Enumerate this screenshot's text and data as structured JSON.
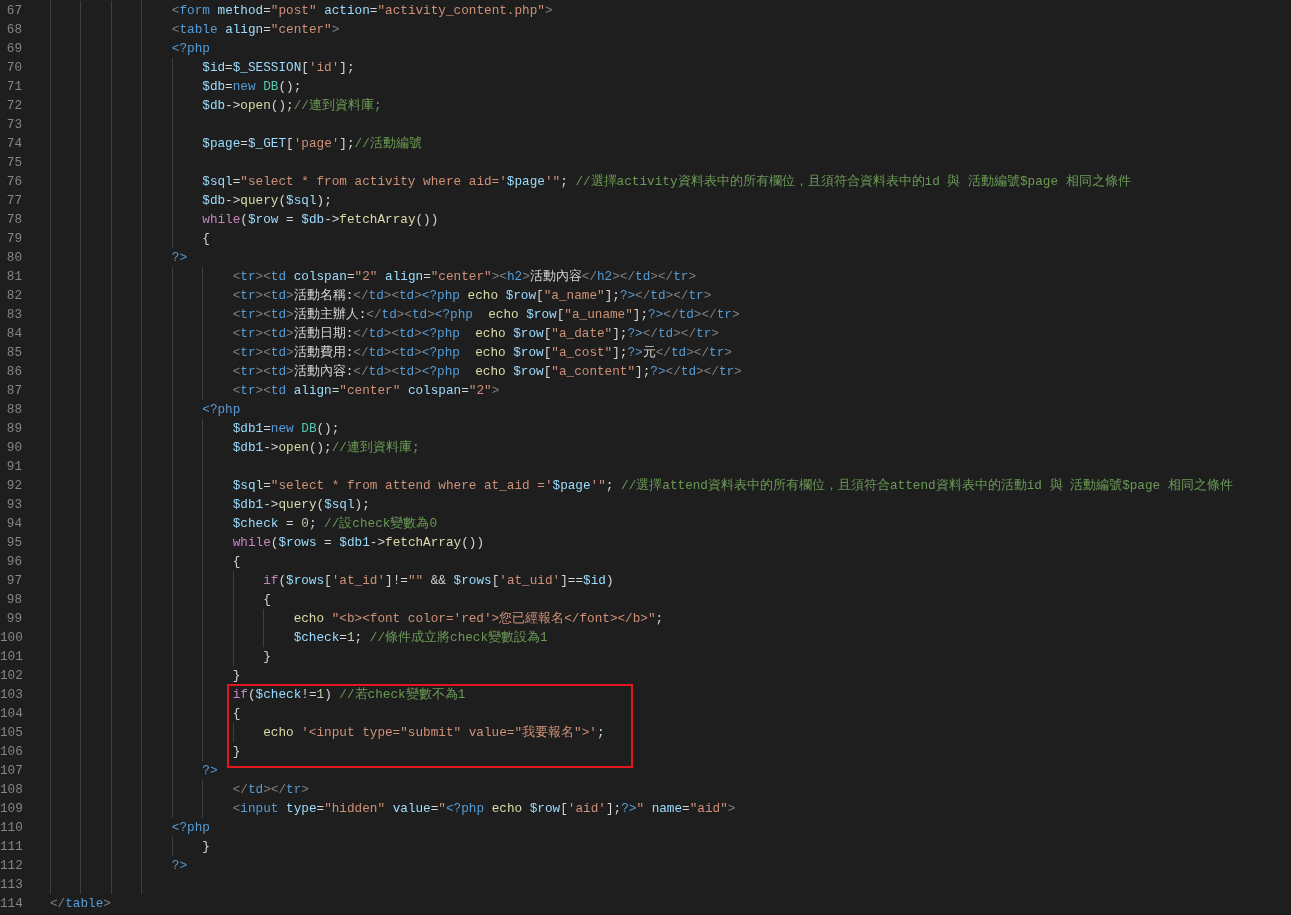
{
  "editor": {
    "lines": [
      {
        "number": "67",
        "boxed": false,
        "tokens": [
          {
            "kind": "punct",
            "text": "                <"
          },
          {
            "kind": "tag",
            "text": "form"
          },
          {
            "kind": "attr",
            "text": " method"
          },
          {
            "kind": "plain",
            "text": "="
          },
          {
            "kind": "string",
            "text": "\"post\""
          },
          {
            "kind": "attr",
            "text": " action"
          },
          {
            "kind": "plain",
            "text": "="
          },
          {
            "kind": "string",
            "text": "\"activity_content.php\""
          },
          {
            "kind": "punct",
            "text": ">"
          }
        ]
      },
      {
        "number": "68",
        "boxed": false,
        "tokens": [
          {
            "kind": "punct",
            "text": "                <"
          },
          {
            "kind": "tag",
            "text": "table"
          },
          {
            "kind": "attr",
            "text": " align"
          },
          {
            "kind": "plain",
            "text": "="
          },
          {
            "kind": "string",
            "text": "\"center\""
          },
          {
            "kind": "punct",
            "text": ">"
          }
        ]
      },
      {
        "number": "69",
        "boxed": false,
        "tokens": [
          {
            "kind": "php",
            "text": "                <?php"
          }
        ]
      },
      {
        "number": "70",
        "boxed": false,
        "tokens": [
          {
            "kind": "var",
            "text": "                    $id"
          },
          {
            "kind": "plain",
            "text": "="
          },
          {
            "kind": "var",
            "text": "$_SESSION"
          },
          {
            "kind": "plain",
            "text": "["
          },
          {
            "kind": "string",
            "text": "'id'"
          },
          {
            "kind": "plain",
            "text": "];"
          }
        ]
      },
      {
        "number": "71",
        "boxed": false,
        "tokens": [
          {
            "kind": "var",
            "text": "                    $db"
          },
          {
            "kind": "plain",
            "text": "="
          },
          {
            "kind": "storage",
            "text": "new"
          },
          {
            "kind": "class",
            "text": " DB"
          },
          {
            "kind": "plain",
            "text": "();"
          }
        ]
      },
      {
        "number": "72",
        "boxed": false,
        "tokens": [
          {
            "kind": "var",
            "text": "                    $db"
          },
          {
            "kind": "plain",
            "text": "->"
          },
          {
            "kind": "func",
            "text": "open"
          },
          {
            "kind": "plain",
            "text": "();"
          },
          {
            "kind": "comment",
            "text": "//連到資料庫;"
          }
        ]
      },
      {
        "number": "73",
        "boxed": false
      },
      {
        "number": "74",
        "boxed": false,
        "tokens": [
          {
            "kind": "var",
            "text": "                    $page"
          },
          {
            "kind": "plain",
            "text": "="
          },
          {
            "kind": "var",
            "text": "$_GET"
          },
          {
            "kind": "plain",
            "text": "["
          },
          {
            "kind": "string",
            "text": "'page'"
          },
          {
            "kind": "plain",
            "text": "];"
          },
          {
            "kind": "comment",
            "text": "//活動編號"
          }
        ]
      },
      {
        "number": "75",
        "boxed": false
      },
      {
        "number": "76",
        "boxed": false,
        "tokens": [
          {
            "kind": "var",
            "text": "                    $sql"
          },
          {
            "kind": "plain",
            "text": "="
          },
          {
            "kind": "string",
            "text": "\"select * from activity where aid='"
          },
          {
            "kind": "var",
            "text": "$page"
          },
          {
            "kind": "string",
            "text": "'\""
          },
          {
            "kind": "plain",
            "text": "; "
          },
          {
            "kind": "comment",
            "text": "//選擇activity資料表中的所有欄位，且須符合資料表中的id 與 活動編號$page 相同之條件"
          }
        ]
      },
      {
        "number": "77",
        "boxed": false,
        "tokens": [
          {
            "kind": "var",
            "text": "                    $db"
          },
          {
            "kind": "plain",
            "text": "->"
          },
          {
            "kind": "func",
            "text": "query"
          },
          {
            "kind": "plain",
            "text": "("
          },
          {
            "kind": "var",
            "text": "$sql"
          },
          {
            "kind": "plain",
            "text": ");"
          }
        ]
      },
      {
        "number": "78",
        "boxed": false,
        "tokens": [
          {
            "kind": "keyword",
            "text": "                    while"
          },
          {
            "kind": "plain",
            "text": "("
          },
          {
            "kind": "var",
            "text": "$row"
          },
          {
            "kind": "plain",
            "text": " = "
          },
          {
            "kind": "var",
            "text": "$db"
          },
          {
            "kind": "plain",
            "text": "->"
          },
          {
            "kind": "func",
            "text": "fetchArray"
          },
          {
            "kind": "plain",
            "text": "())"
          }
        ]
      },
      {
        "number": "79",
        "boxed": false,
        "tokens": [
          {
            "kind": "plain",
            "text": "                    {"
          }
        ]
      },
      {
        "number": "80",
        "boxed": false,
        "tokens": [
          {
            "kind": "php",
            "text": "                ?>"
          }
        ]
      },
      {
        "number": "81",
        "boxed": false,
        "tokens": [
          {
            "kind": "punct",
            "text": "                        <"
          },
          {
            "kind": "tag",
            "text": "tr"
          },
          {
            "kind": "punct",
            "text": "><"
          },
          {
            "kind": "tag",
            "text": "td"
          },
          {
            "kind": "attr",
            "text": " colspan"
          },
          {
            "kind": "plain",
            "text": "="
          },
          {
            "kind": "string",
            "text": "\"2\""
          },
          {
            "kind": "attr",
            "text": " align"
          },
          {
            "kind": "plain",
            "text": "="
          },
          {
            "kind": "string",
            "text": "\"center\""
          },
          {
            "kind": "punct",
            "text": "><"
          },
          {
            "kind": "tag",
            "text": "h2"
          },
          {
            "kind": "punct",
            "text": ">"
          },
          {
            "kind": "plain",
            "text": "活動內容"
          },
          {
            "kind": "punct",
            "text": "</"
          },
          {
            "kind": "tag",
            "text": "h2"
          },
          {
            "kind": "punct",
            "text": "></"
          },
          {
            "kind": "tag",
            "text": "td"
          },
          {
            "kind": "punct",
            "text": "></"
          },
          {
            "kind": "tag",
            "text": "tr"
          },
          {
            "kind": "punct",
            "text": ">"
          }
        ]
      },
      {
        "number": "82",
        "boxed": false,
        "tokens": [
          {
            "kind": "punct",
            "text": "                        <"
          },
          {
            "kind": "tag",
            "text": "tr"
          },
          {
            "kind": "punct",
            "text": "><"
          },
          {
            "kind": "tag",
            "text": "td"
          },
          {
            "kind": "punct",
            "text": ">"
          },
          {
            "kind": "plain",
            "text": "活動名稱:"
          },
          {
            "kind": "punct",
            "text": "</"
          },
          {
            "kind": "tag",
            "text": "td"
          },
          {
            "kind": "punct",
            "text": "><"
          },
          {
            "kind": "tag",
            "text": "td"
          },
          {
            "kind": "punct",
            "text": ">"
          },
          {
            "kind": "php",
            "text": "<?php"
          },
          {
            "kind": "func",
            "text": " echo"
          },
          {
            "kind": "var",
            "text": " $row"
          },
          {
            "kind": "plain",
            "text": "["
          },
          {
            "kind": "string",
            "text": "\"a_name\""
          },
          {
            "kind": "plain",
            "text": "];"
          },
          {
            "kind": "php",
            "text": "?>"
          },
          {
            "kind": "punct",
            "text": "</"
          },
          {
            "kind": "tag",
            "text": "td"
          },
          {
            "kind": "punct",
            "text": "></"
          },
          {
            "kind": "tag",
            "text": "tr"
          },
          {
            "kind": "punct",
            "text": ">"
          }
        ]
      },
      {
        "number": "83",
        "boxed": false,
        "tokens": [
          {
            "kind": "punct",
            "text": "                        <"
          },
          {
            "kind": "tag",
            "text": "tr"
          },
          {
            "kind": "punct",
            "text": "><"
          },
          {
            "kind": "tag",
            "text": "td"
          },
          {
            "kind": "punct",
            "text": ">"
          },
          {
            "kind": "plain",
            "text": "活動主辦人:"
          },
          {
            "kind": "punct",
            "text": "</"
          },
          {
            "kind": "tag",
            "text": "td"
          },
          {
            "kind": "punct",
            "text": "><"
          },
          {
            "kind": "tag",
            "text": "td"
          },
          {
            "kind": "punct",
            "text": ">"
          },
          {
            "kind": "php",
            "text": "<?php"
          },
          {
            "kind": "func",
            "text": "  echo"
          },
          {
            "kind": "var",
            "text": " $row"
          },
          {
            "kind": "plain",
            "text": "["
          },
          {
            "kind": "string",
            "text": "\"a_uname\""
          },
          {
            "kind": "plain",
            "text": "];"
          },
          {
            "kind": "php",
            "text": "?>"
          },
          {
            "kind": "punct",
            "text": "</"
          },
          {
            "kind": "tag",
            "text": "td"
          },
          {
            "kind": "punct",
            "text": "></"
          },
          {
            "kind": "tag",
            "text": "tr"
          },
          {
            "kind": "punct",
            "text": ">"
          }
        ]
      },
      {
        "number": "84",
        "boxed": false,
        "tokens": [
          {
            "kind": "punct",
            "text": "                        <"
          },
          {
            "kind": "tag",
            "text": "tr"
          },
          {
            "kind": "punct",
            "text": "><"
          },
          {
            "kind": "tag",
            "text": "td"
          },
          {
            "kind": "punct",
            "text": ">"
          },
          {
            "kind": "plain",
            "text": "活動日期:"
          },
          {
            "kind": "punct",
            "text": "</"
          },
          {
            "kind": "tag",
            "text": "td"
          },
          {
            "kind": "punct",
            "text": "><"
          },
          {
            "kind": "tag",
            "text": "td"
          },
          {
            "kind": "punct",
            "text": ">"
          },
          {
            "kind": "php",
            "text": "<?php"
          },
          {
            "kind": "func",
            "text": "  echo"
          },
          {
            "kind": "var",
            "text": " $row"
          },
          {
            "kind": "plain",
            "text": "["
          },
          {
            "kind": "string",
            "text": "\"a_date\""
          },
          {
            "kind": "plain",
            "text": "];"
          },
          {
            "kind": "php",
            "text": "?>"
          },
          {
            "kind": "punct",
            "text": "</"
          },
          {
            "kind": "tag",
            "text": "td"
          },
          {
            "kind": "punct",
            "text": "></"
          },
          {
            "kind": "tag",
            "text": "tr"
          },
          {
            "kind": "punct",
            "text": ">"
          }
        ]
      },
      {
        "number": "85",
        "boxed": false,
        "tokens": [
          {
            "kind": "punct",
            "text": "                        <"
          },
          {
            "kind": "tag",
            "text": "tr"
          },
          {
            "kind": "punct",
            "text": "><"
          },
          {
            "kind": "tag",
            "text": "td"
          },
          {
            "kind": "punct",
            "text": ">"
          },
          {
            "kind": "plain",
            "text": "活動費用:"
          },
          {
            "kind": "punct",
            "text": "</"
          },
          {
            "kind": "tag",
            "text": "td"
          },
          {
            "kind": "punct",
            "text": "><"
          },
          {
            "kind": "tag",
            "text": "td"
          },
          {
            "kind": "punct",
            "text": ">"
          },
          {
            "kind": "php",
            "text": "<?php"
          },
          {
            "kind": "func",
            "text": "  echo"
          },
          {
            "kind": "var",
            "text": " $row"
          },
          {
            "kind": "plain",
            "text": "["
          },
          {
            "kind": "string",
            "text": "\"a_cost\""
          },
          {
            "kind": "plain",
            "text": "];"
          },
          {
            "kind": "php",
            "text": "?>"
          },
          {
            "kind": "plain",
            "text": "元"
          },
          {
            "kind": "punct",
            "text": "</"
          },
          {
            "kind": "tag",
            "text": "td"
          },
          {
            "kind": "punct",
            "text": "></"
          },
          {
            "kind": "tag",
            "text": "tr"
          },
          {
            "kind": "punct",
            "text": ">"
          }
        ]
      },
      {
        "number": "86",
        "boxed": false,
        "tokens": [
          {
            "kind": "punct",
            "text": "                        <"
          },
          {
            "kind": "tag",
            "text": "tr"
          },
          {
            "kind": "punct",
            "text": "><"
          },
          {
            "kind": "tag",
            "text": "td"
          },
          {
            "kind": "punct",
            "text": ">"
          },
          {
            "kind": "plain",
            "text": "活動內容:"
          },
          {
            "kind": "punct",
            "text": "</"
          },
          {
            "kind": "tag",
            "text": "td"
          },
          {
            "kind": "punct",
            "text": "><"
          },
          {
            "kind": "tag",
            "text": "td"
          },
          {
            "kind": "punct",
            "text": ">"
          },
          {
            "kind": "php",
            "text": "<?php"
          },
          {
            "kind": "func",
            "text": "  echo"
          },
          {
            "kind": "var",
            "text": " $row"
          },
          {
            "kind": "plain",
            "text": "["
          },
          {
            "kind": "string",
            "text": "\"a_content\""
          },
          {
            "kind": "plain",
            "text": "];"
          },
          {
            "kind": "php",
            "text": "?>"
          },
          {
            "kind": "punct",
            "text": "</"
          },
          {
            "kind": "tag",
            "text": "td"
          },
          {
            "kind": "punct",
            "text": "></"
          },
          {
            "kind": "tag",
            "text": "tr"
          },
          {
            "kind": "punct",
            "text": ">"
          }
        ]
      },
      {
        "number": "87",
        "boxed": false,
        "tokens": [
          {
            "kind": "punct",
            "text": "                        <"
          },
          {
            "kind": "tag",
            "text": "tr"
          },
          {
            "kind": "punct",
            "text": "><"
          },
          {
            "kind": "tag",
            "text": "td"
          },
          {
            "kind": "attr",
            "text": " align"
          },
          {
            "kind": "plain",
            "text": "="
          },
          {
            "kind": "string",
            "text": "\"center\""
          },
          {
            "kind": "attr",
            "text": " colspan"
          },
          {
            "kind": "plain",
            "text": "="
          },
          {
            "kind": "string",
            "text": "\"2\""
          },
          {
            "kind": "punct",
            "text": ">"
          }
        ]
      },
      {
        "number": "88",
        "boxed": false,
        "tokens": [
          {
            "kind": "php",
            "text": "                    <?php"
          }
        ]
      },
      {
        "number": "89",
        "boxed": false,
        "tokens": [
          {
            "kind": "var",
            "text": "                        $db1"
          },
          {
            "kind": "plain",
            "text": "="
          },
          {
            "kind": "storage",
            "text": "new"
          },
          {
            "kind": "class",
            "text": " DB"
          },
          {
            "kind": "plain",
            "text": "();"
          }
        ]
      },
      {
        "number": "90",
        "boxed": false,
        "tokens": [
          {
            "kind": "var",
            "text": "                        $db1"
          },
          {
            "kind": "plain",
            "text": "->"
          },
          {
            "kind": "func",
            "text": "open"
          },
          {
            "kind": "plain",
            "text": "();"
          },
          {
            "kind": "comment",
            "text": "//連到資料庫;"
          }
        ]
      },
      {
        "number": "91",
        "boxed": false
      },
      {
        "number": "92",
        "boxed": false,
        "tokens": [
          {
            "kind": "var",
            "text": "                        $sql"
          },
          {
            "kind": "plain",
            "text": "="
          },
          {
            "kind": "string",
            "text": "\"select * from attend where at_aid ='"
          },
          {
            "kind": "var",
            "text": "$page"
          },
          {
            "kind": "string",
            "text": "'\""
          },
          {
            "kind": "plain",
            "text": "; "
          },
          {
            "kind": "comment",
            "text": "//選擇attend資料表中的所有欄位，且須符合attend資料表中的活動id 與 活動編號$page 相同之條件"
          }
        ]
      },
      {
        "number": "93",
        "boxed": false,
        "tokens": [
          {
            "kind": "var",
            "text": "                        $db1"
          },
          {
            "kind": "plain",
            "text": "->"
          },
          {
            "kind": "func",
            "text": "query"
          },
          {
            "kind": "plain",
            "text": "("
          },
          {
            "kind": "var",
            "text": "$sql"
          },
          {
            "kind": "plain",
            "text": ");"
          }
        ]
      },
      {
        "number": "94",
        "boxed": false,
        "tokens": [
          {
            "kind": "var",
            "text": "                        $check"
          },
          {
            "kind": "plain",
            "text": " = "
          },
          {
            "kind": "number",
            "text": "0"
          },
          {
            "kind": "plain",
            "text": "; "
          },
          {
            "kind": "comment",
            "text": "//設check變數為0"
          }
        ]
      },
      {
        "number": "95",
        "boxed": false,
        "tokens": [
          {
            "kind": "keyword",
            "text": "                        while"
          },
          {
            "kind": "plain",
            "text": "("
          },
          {
            "kind": "var",
            "text": "$rows"
          },
          {
            "kind": "plain",
            "text": " = "
          },
          {
            "kind": "var",
            "text": "$db1"
          },
          {
            "kind": "plain",
            "text": "->"
          },
          {
            "kind": "func",
            "text": "fetchArray"
          },
          {
            "kind": "plain",
            "text": "())"
          }
        ]
      },
      {
        "number": "96",
        "boxed": false,
        "tokens": [
          {
            "kind": "plain",
            "text": "                        {"
          }
        ]
      },
      {
        "number": "97",
        "boxed": false,
        "tokens": [
          {
            "kind": "keyword",
            "text": "                            if"
          },
          {
            "kind": "plain",
            "text": "("
          },
          {
            "kind": "var",
            "text": "$rows"
          },
          {
            "kind": "plain",
            "text": "["
          },
          {
            "kind": "string",
            "text": "'at_id'"
          },
          {
            "kind": "plain",
            "text": "]!="
          },
          {
            "kind": "string",
            "text": "\"\""
          },
          {
            "kind": "plain",
            "text": " && "
          },
          {
            "kind": "var",
            "text": "$rows"
          },
          {
            "kind": "plain",
            "text": "["
          },
          {
            "kind": "string",
            "text": "'at_uid'"
          },
          {
            "kind": "plain",
            "text": "]=="
          },
          {
            "kind": "var",
            "text": "$id"
          },
          {
            "kind": "plain",
            "text": ")"
          }
        ]
      },
      {
        "number": "98",
        "boxed": false,
        "tokens": [
          {
            "kind": "plain",
            "text": "                            {"
          }
        ]
      },
      {
        "number": "99",
        "boxed": false,
        "tokens": [
          {
            "kind": "func",
            "text": "                                echo"
          },
          {
            "kind": "string",
            "text": " \"<b><font color='red'>您已經報名</font></b>\""
          },
          {
            "kind": "plain",
            "text": ";"
          }
        ]
      },
      {
        "number": "100",
        "boxed": false,
        "tokens": [
          {
            "kind": "var",
            "text": "                                $check"
          },
          {
            "kind": "plain",
            "text": "="
          },
          {
            "kind": "number",
            "text": "1"
          },
          {
            "kind": "plain",
            "text": "; "
          },
          {
            "kind": "comment",
            "text": "//條件成立將check變數設為1"
          }
        ]
      },
      {
        "number": "101",
        "boxed": false,
        "tokens": [
          {
            "kind": "plain",
            "text": "                            }"
          }
        ]
      },
      {
        "number": "102",
        "boxed": false,
        "tokens": [
          {
            "kind": "plain",
            "text": "                        }"
          }
        ]
      },
      {
        "number": "103",
        "boxed": true,
        "tokens": [
          {
            "kind": "keyword",
            "text": "                        if"
          },
          {
            "kind": "plain",
            "text": "("
          },
          {
            "kind": "var",
            "text": "$check"
          },
          {
            "kind": "plain",
            "text": "!="
          },
          {
            "kind": "number",
            "text": "1"
          },
          {
            "kind": "plain",
            "text": ") "
          },
          {
            "kind": "comment",
            "text": "//若check變數不為1"
          }
        ]
      },
      {
        "number": "104",
        "boxed": true,
        "tokens": [
          {
            "kind": "plain",
            "text": "                        {"
          }
        ]
      },
      {
        "number": "105",
        "boxed": true,
        "tokens": [
          {
            "kind": "func",
            "text": "                            echo"
          },
          {
            "kind": "string",
            "text": " '<input type=\"submit\" value=\"我要報名\">'"
          },
          {
            "kind": "plain",
            "text": ";"
          }
        ]
      },
      {
        "number": "106",
        "boxed": true,
        "tokens": [
          {
            "kind": "plain",
            "text": "                        }"
          }
        ]
      },
      {
        "number": "107",
        "boxed": false,
        "tokens": [
          {
            "kind": "php",
            "text": "                    ?>"
          }
        ]
      },
      {
        "number": "108",
        "boxed": false,
        "tokens": [
          {
            "kind": "punct",
            "text": "                        </"
          },
          {
            "kind": "tag",
            "text": "td"
          },
          {
            "kind": "punct",
            "text": "></"
          },
          {
            "kind": "tag",
            "text": "tr"
          },
          {
            "kind": "punct",
            "text": ">"
          }
        ]
      },
      {
        "number": "109",
        "boxed": false,
        "tokens": [
          {
            "kind": "punct",
            "text": "                        <"
          },
          {
            "kind": "tag",
            "text": "input"
          },
          {
            "kind": "attr",
            "text": " type"
          },
          {
            "kind": "plain",
            "text": "="
          },
          {
            "kind": "string",
            "text": "\"hidden\""
          },
          {
            "kind": "attr",
            "text": " value"
          },
          {
            "kind": "plain",
            "text": "="
          },
          {
            "kind": "string",
            "text": "\""
          },
          {
            "kind": "php",
            "text": "<?php"
          },
          {
            "kind": "func",
            "text": " echo"
          },
          {
            "kind": "var",
            "text": " $row"
          },
          {
            "kind": "plain",
            "text": "["
          },
          {
            "kind": "string",
            "text": "'aid'"
          },
          {
            "kind": "plain",
            "text": "];"
          },
          {
            "kind": "php",
            "text": "?>"
          },
          {
            "kind": "string",
            "text": "\""
          },
          {
            "kind": "attr",
            "text": " name"
          },
          {
            "kind": "plain",
            "text": "="
          },
          {
            "kind": "string",
            "text": "\"aid\""
          },
          {
            "kind": "punct",
            "text": ">"
          }
        ]
      },
      {
        "number": "110",
        "boxed": false,
        "tokens": [
          {
            "kind": "php",
            "text": "                <?php"
          }
        ]
      },
      {
        "number": "111",
        "boxed": false,
        "tokens": [
          {
            "kind": "plain",
            "text": "                    }"
          }
        ]
      },
      {
        "number": "112",
        "boxed": false,
        "tokens": [
          {
            "kind": "php",
            "text": "                ?>"
          }
        ]
      },
      {
        "number": "113",
        "boxed": false
      },
      {
        "number": "114",
        "boxed": false,
        "tokens": [
          {
            "kind": "punct",
            "text": "</"
          },
          {
            "kind": "tag",
            "text": "table"
          },
          {
            "kind": "punct",
            "text": ">"
          }
        ]
      }
    ]
  }
}
